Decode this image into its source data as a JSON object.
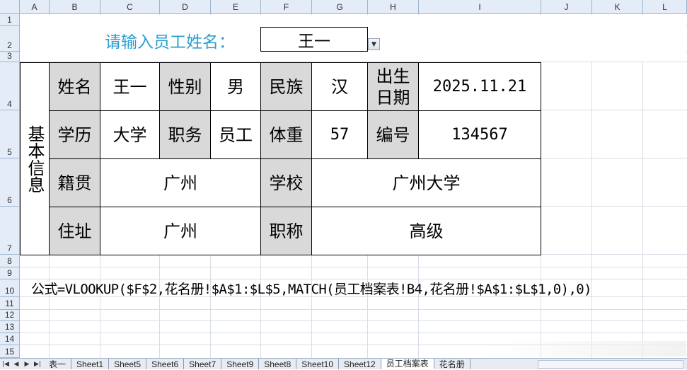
{
  "columns": [
    "A",
    "B",
    "C",
    "D",
    "E",
    "F",
    "G",
    "H",
    "I",
    "J",
    "K",
    "L"
  ],
  "rows": [
    "1",
    "2",
    "3",
    "4",
    "5",
    "6",
    "7",
    "8",
    "9",
    "10",
    "11",
    "12",
    "13",
    "14",
    "15"
  ],
  "prompt": {
    "label": "请输入员工姓名：",
    "value": "王一"
  },
  "record": {
    "section_label": "基本信息",
    "row1": {
      "name_label": "姓名",
      "name": "王一",
      "gender_label": "性别",
      "gender": "男",
      "ethnicity_label": "民族",
      "ethnicity": "汉",
      "birth_label": "出生\n日期",
      "birth": "2025.11.21"
    },
    "row2": {
      "education_label": "学历",
      "education": "大学",
      "position_label": "职务",
      "position": "员工",
      "weight_label": "体重",
      "weight": "57",
      "id_label": "编号",
      "id": "134567"
    },
    "row3": {
      "hometown_label": "籍贯",
      "hometown": "广州",
      "school_label": "学校",
      "school": "广州大学"
    },
    "row4": {
      "address_label": "住址",
      "address": "广州",
      "title_label": "职称",
      "title": "高级"
    }
  },
  "formula": "公式=VLOOKUP($F$2,花名册!$A$1:$L$5,MATCH(员工档案表!B4,花名册!$A$1:$L$1,0),0)",
  "sheet_tabs": [
    {
      "label": "表一",
      "active": false
    },
    {
      "label": "Sheet1",
      "active": false
    },
    {
      "label": "Sheet5",
      "active": false
    },
    {
      "label": "Sheet6",
      "active": false
    },
    {
      "label": "Sheet7",
      "active": false
    },
    {
      "label": "Sheet9",
      "active": false
    },
    {
      "label": "Sheet8",
      "active": false
    },
    {
      "label": "Sheet10",
      "active": false
    },
    {
      "label": "Sheet12",
      "active": false
    },
    {
      "label": "员工档案表",
      "active": true
    },
    {
      "label": "花名册",
      "active": false
    }
  ],
  "icons": {
    "dropdown": "chevron-down-icon",
    "nav_first": "first-sheet-icon",
    "nav_prev": "prev-sheet-icon",
    "nav_next": "next-sheet-icon",
    "nav_last": "last-sheet-icon"
  },
  "colors": {
    "prompt_text": "#2b9fd0",
    "label_fill": "#d9d9d9",
    "header_fill": "#e4ecf7"
  }
}
